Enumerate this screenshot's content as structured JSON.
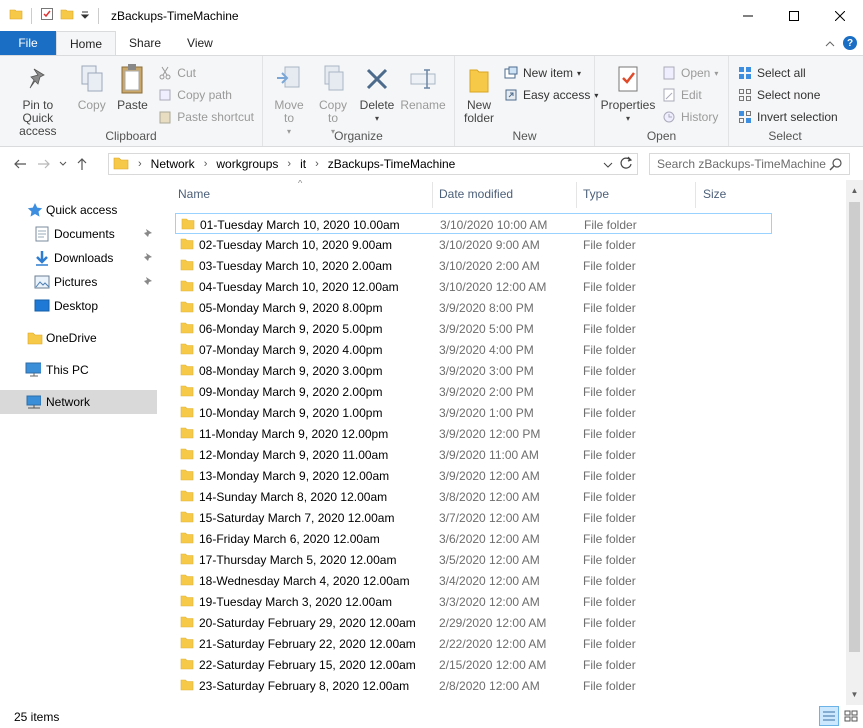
{
  "window": {
    "title": "zBackups-TimeMachine"
  },
  "ribbon_tabs": {
    "file": "File",
    "home": "Home",
    "share": "Share",
    "view": "View"
  },
  "clipboard": {
    "pin": "Pin to Quick access",
    "copy": "Copy",
    "paste": "Paste",
    "cut": "Cut",
    "copy_path": "Copy path",
    "paste_shortcut": "Paste shortcut",
    "label": "Clipboard"
  },
  "organize": {
    "move_to": "Move to",
    "copy_to": "Copy to",
    "delete": "Delete",
    "rename": "Rename",
    "label": "Organize"
  },
  "new": {
    "new_folder": "New folder",
    "new_item": "New item",
    "easy_access": "Easy access",
    "label": "New"
  },
  "open": {
    "properties": "Properties",
    "open": "Open",
    "edit": "Edit",
    "history": "History",
    "label": "Open"
  },
  "select": {
    "select_all": "Select all",
    "select_none": "Select none",
    "invert": "Invert selection",
    "label": "Select"
  },
  "address": {
    "crumbs": [
      "Network",
      "workgroups",
      "it",
      "zBackups-TimeMachine"
    ]
  },
  "search": {
    "placeholder": "Search zBackups-TimeMachine"
  },
  "nav": {
    "quick_access": "Quick access",
    "documents": "Documents",
    "downloads": "Downloads",
    "pictures": "Pictures",
    "desktop": "Desktop",
    "onedrive": "OneDrive",
    "this_pc": "This PC",
    "network": "Network"
  },
  "columns": {
    "name": "Name",
    "date": "Date modified",
    "type": "Type",
    "size": "Size"
  },
  "files": [
    {
      "name": "01-Tuesday March 10, 2020 10.00am",
      "date": "3/10/2020 10:00 AM",
      "type": "File folder"
    },
    {
      "name": "02-Tuesday March 10, 2020  9.00am",
      "date": "3/10/2020 9:00 AM",
      "type": "File folder"
    },
    {
      "name": "03-Tuesday March 10, 2020  2.00am",
      "date": "3/10/2020 2:00 AM",
      "type": "File folder"
    },
    {
      "name": "04-Tuesday March 10, 2020 12.00am",
      "date": "3/10/2020 12:00 AM",
      "type": "File folder"
    },
    {
      "name": "05-Monday March 9, 2020  8.00pm",
      "date": "3/9/2020 8:00 PM",
      "type": "File folder"
    },
    {
      "name": "06-Monday March 9, 2020  5.00pm",
      "date": "3/9/2020 5:00 PM",
      "type": "File folder"
    },
    {
      "name": "07-Monday March 9, 2020  4.00pm",
      "date": "3/9/2020 4:00 PM",
      "type": "File folder"
    },
    {
      "name": "08-Monday March 9, 2020  3.00pm",
      "date": "3/9/2020 3:00 PM",
      "type": "File folder"
    },
    {
      "name": "09-Monday March 9, 2020  2.00pm",
      "date": "3/9/2020 2:00 PM",
      "type": "File folder"
    },
    {
      "name": "10-Monday March 9, 2020  1.00pm",
      "date": "3/9/2020 1:00 PM",
      "type": "File folder"
    },
    {
      "name": "11-Monday March 9, 2020 12.00pm",
      "date": "3/9/2020 12:00 PM",
      "type": "File folder"
    },
    {
      "name": "12-Monday March 9, 2020 11.00am",
      "date": "3/9/2020 11:00 AM",
      "type": "File folder"
    },
    {
      "name": "13-Monday March 9, 2020 12.00am",
      "date": "3/9/2020 12:00 AM",
      "type": "File folder"
    },
    {
      "name": "14-Sunday March 8, 2020 12.00am",
      "date": "3/8/2020 12:00 AM",
      "type": "File folder"
    },
    {
      "name": "15-Saturday March 7, 2020 12.00am",
      "date": "3/7/2020 12:00 AM",
      "type": "File folder"
    },
    {
      "name": "16-Friday March 6, 2020 12.00am",
      "date": "3/6/2020 12:00 AM",
      "type": "File folder"
    },
    {
      "name": "17-Thursday March 5, 2020 12.00am",
      "date": "3/5/2020 12:00 AM",
      "type": "File folder"
    },
    {
      "name": "18-Wednesday March 4, 2020 12.00am",
      "date": "3/4/2020 12:00 AM",
      "type": "File folder"
    },
    {
      "name": "19-Tuesday March 3, 2020 12.00am",
      "date": "3/3/2020 12:00 AM",
      "type": "File folder"
    },
    {
      "name": "20-Saturday February 29, 2020 12.00am",
      "date": "2/29/2020 12:00 AM",
      "type": "File folder"
    },
    {
      "name": "21-Saturday February 22, 2020 12.00am",
      "date": "2/22/2020 12:00 AM",
      "type": "File folder"
    },
    {
      "name": "22-Saturday February 15, 2020 12.00am",
      "date": "2/15/2020 12:00 AM",
      "type": "File folder"
    },
    {
      "name": "23-Saturday February 8, 2020 12.00am",
      "date": "2/8/2020 12:00 AM",
      "type": "File folder"
    }
  ],
  "status": {
    "count": "25 items"
  },
  "colors": {
    "accent": "#1a6ec4",
    "folder": "#f7c948",
    "selected_nav": "#d9d9d9"
  }
}
